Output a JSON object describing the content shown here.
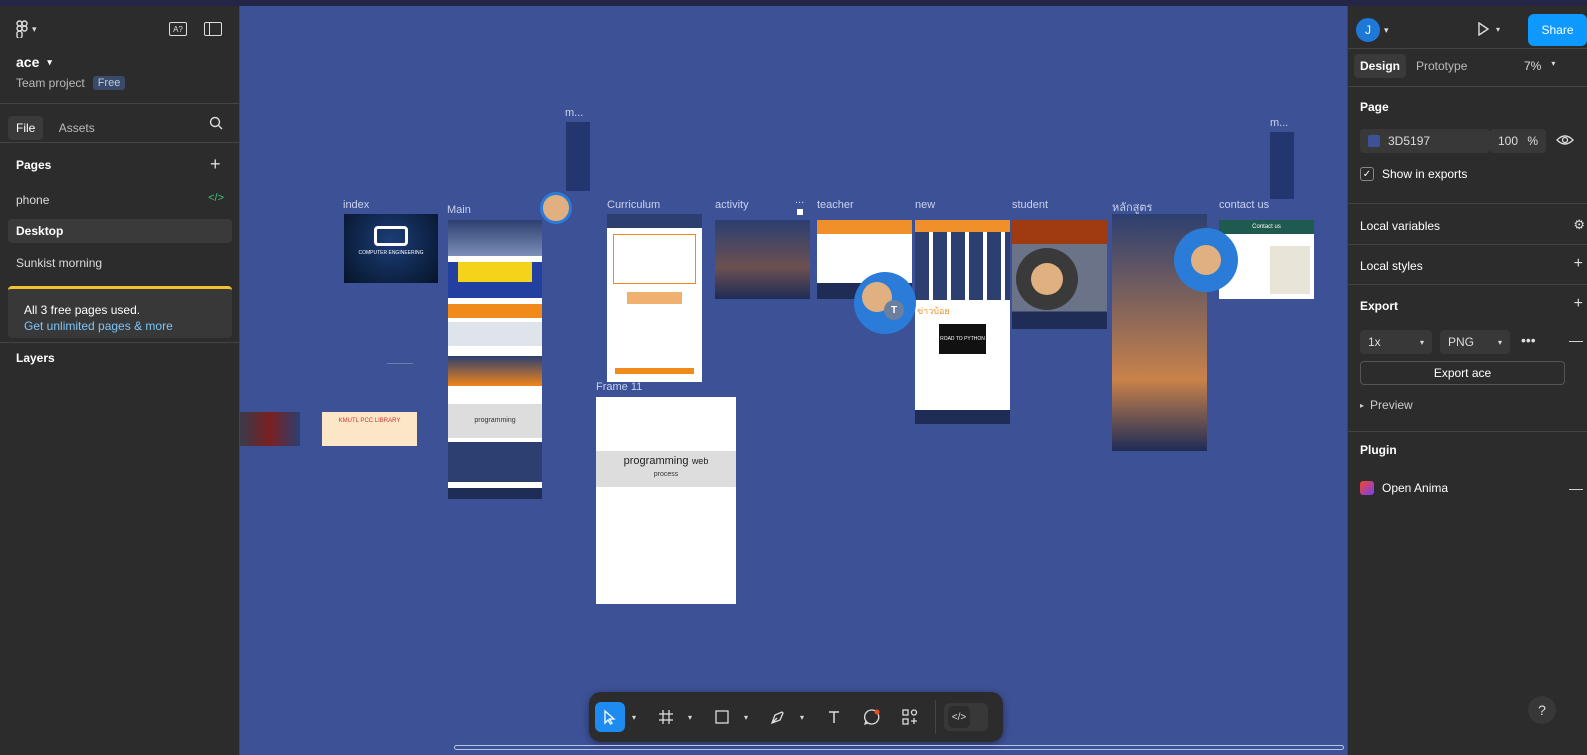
{
  "app": {
    "file_name": "ace",
    "project": "Team project",
    "plan_badge": "Free"
  },
  "left_panel": {
    "tabs": [
      "File",
      "Assets"
    ],
    "pages_title": "Pages",
    "pages": [
      {
        "name": "phone",
        "has_dev_icon": true
      },
      {
        "name": "Desktop",
        "active": true
      },
      {
        "name": "Sunkist morning"
      }
    ],
    "upgrade": {
      "text": "All 3 free pages used.",
      "link": "Get unlimited pages & more"
    },
    "layers_title": "Layers"
  },
  "canvas": {
    "background": "#3D5197",
    "frames": [
      {
        "label": "index"
      },
      {
        "label": "Main"
      },
      {
        "label": "m..."
      },
      {
        "label": "Curriculum"
      },
      {
        "label": "activity"
      },
      {
        "label": "..."
      },
      {
        "label": "teacher"
      },
      {
        "label": "new"
      },
      {
        "label": "student"
      },
      {
        "label": "หลักสูตร"
      },
      {
        "label": "contact us"
      },
      {
        "label": "m..."
      },
      {
        "label": "Frame 11"
      }
    ],
    "thumb_text": {
      "index_logo": "COMPUTER ENGINEERING",
      "library": "KMUTL PCC LIBRARY",
      "programming": "programming",
      "web": "web",
      "process": "process",
      "python": "ROAD TO PYTHON",
      "contact": "Contact us",
      "news_heading": "ข่าวบ้อย"
    },
    "avatar_initial": "T"
  },
  "toolbar": {
    "tools": [
      "move-tool",
      "frame-tool",
      "shape-tool",
      "pen-tool",
      "text-tool",
      "comment-tool",
      "actions-tool",
      "dev-mode-toggle"
    ]
  },
  "right_panel": {
    "user_initial": "J",
    "share_label": "Share",
    "tabs": [
      "Design",
      "Prototype"
    ],
    "zoom": "7%",
    "page_section": "Page",
    "page_color_hex": "3D5197",
    "page_color": "#3D5197",
    "opacity": "100",
    "percent": "%",
    "show_in_exports": "Show in exports",
    "local_variables": "Local variables",
    "local_styles": "Local styles",
    "export_title": "Export",
    "export_scale": "1x",
    "export_format": "PNG",
    "export_button": "Export ace",
    "preview_label": "Preview",
    "plugin_title": "Plugin",
    "plugin_name": "Open Anima"
  }
}
